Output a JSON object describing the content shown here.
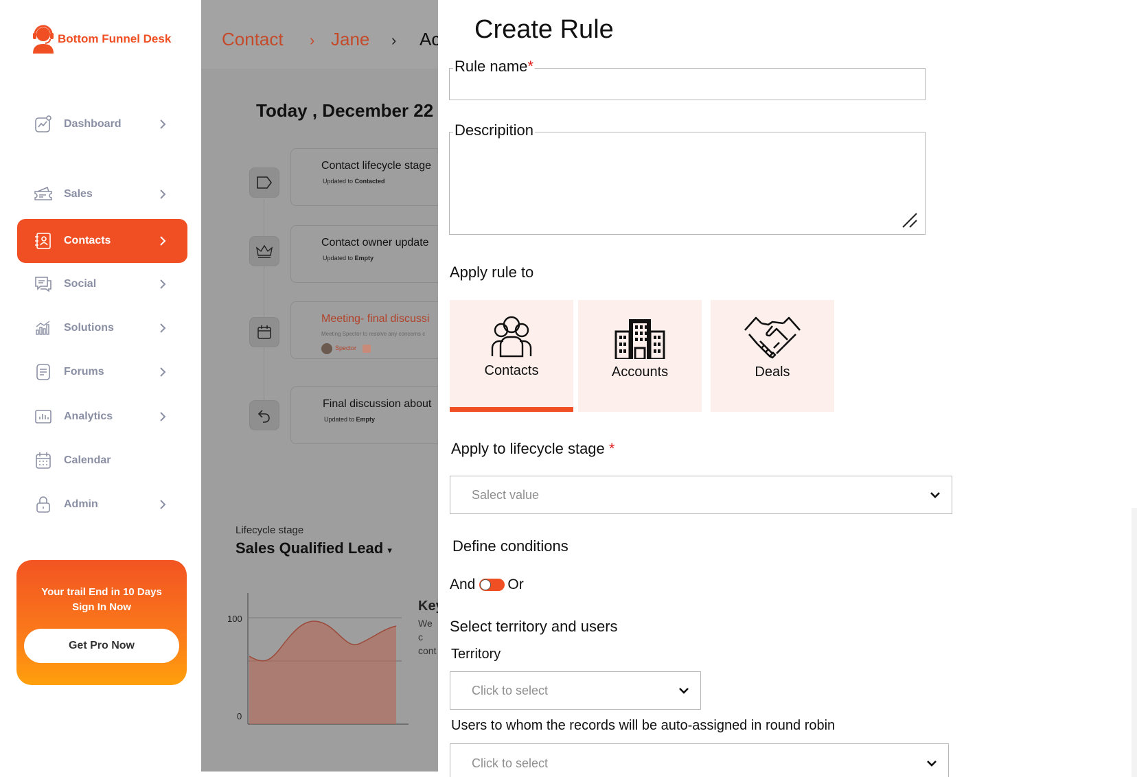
{
  "brand": {
    "name": "Bottom Funnel Desk",
    "accent": "#f04e23"
  },
  "sidebar": {
    "items": [
      {
        "label": "Dashboard",
        "icon": "dashboard-icon",
        "has_chevron": true,
        "active": false
      },
      {
        "label": "Sales",
        "icon": "ticket-icon",
        "has_chevron": true,
        "active": false
      },
      {
        "label": "Contacts",
        "icon": "contacts-icon",
        "has_chevron": true,
        "active": true
      },
      {
        "label": "Social",
        "icon": "chat-icon",
        "has_chevron": true,
        "active": false
      },
      {
        "label": "Solutions",
        "icon": "solutions-icon",
        "has_chevron": true,
        "active": false
      },
      {
        "label": "Forums",
        "icon": "forums-icon",
        "has_chevron": true,
        "active": false
      },
      {
        "label": "Analytics",
        "icon": "analytics-icon",
        "has_chevron": true,
        "active": false
      },
      {
        "label": "Calendar",
        "icon": "calendar-icon",
        "has_chevron": false,
        "active": false
      },
      {
        "label": "Admin",
        "icon": "lock-icon",
        "has_chevron": true,
        "active": false
      }
    ],
    "promo": {
      "line1": "Your trail End in 10 Days",
      "line2": "Sign In Now",
      "button": "Get Pro Now"
    }
  },
  "main": {
    "breadcrumb": [
      "Contact",
      "Jane",
      "Ac"
    ],
    "date_heading": "Today , December 22",
    "timeline": [
      {
        "title": "Contact lifecycle stage",
        "sub_prefix": "Updated to ",
        "sub_value": "Contacted",
        "icon": "tag-icon"
      },
      {
        "title": "Contact owner update",
        "sub_prefix": "Updated to ",
        "sub_value": "Empty",
        "icon": "crown-icon"
      },
      {
        "title": "Meeting- final discussi",
        "sub_prefix": "Meeting Spector to resolve any concerns c",
        "sub_value": "Spector",
        "icon": "calendar-icon"
      },
      {
        "title": "Final discussion about",
        "sub_prefix": "Updated to ",
        "sub_value": "Empty",
        "icon": "reply-icon"
      }
    ],
    "lifecycle": {
      "label": "Lifecycle stage",
      "value": "Sales Qualified Lead"
    },
    "chart_ticks": {
      "top": "100",
      "bottom": "0"
    },
    "key": {
      "title": "Key",
      "line1": "We c",
      "line2": "cont"
    }
  },
  "panel": {
    "title": "Create Rule",
    "rule_name": {
      "label": "Rule name",
      "required_mark": "*",
      "value": ""
    },
    "description": {
      "label": "Descripition",
      "value": ""
    },
    "apply_rule_to": {
      "label": "Apply rule to",
      "options": [
        {
          "label": "Contacts",
          "icon": "contacts-group-icon",
          "selected": true
        },
        {
          "label": "Accounts",
          "icon": "building-icon",
          "selected": false
        },
        {
          "label": "Deals",
          "icon": "handshake-icon",
          "selected": false
        }
      ]
    },
    "lifecycle_stage": {
      "label": "Apply to lifecycle stage",
      "required_mark": "*",
      "placeholder": "Salect value"
    },
    "conditions": {
      "label": "Define conditions",
      "left": "And",
      "right": "Or",
      "value": "Or"
    },
    "territory_users": {
      "label": "Select territory and users",
      "territory_label": "Territory",
      "territory_placeholder": "Click to select",
      "users_label": "Users to whom the records will be auto-assigned in round robin",
      "users_placeholder": "Click to select"
    }
  }
}
